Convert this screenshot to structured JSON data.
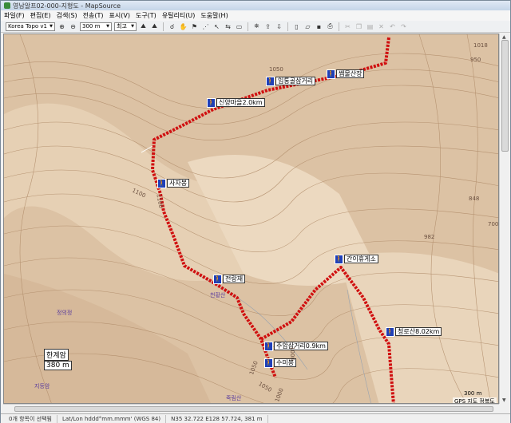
{
  "window": {
    "title": "영남알프02-000-지형도 - MapSource"
  },
  "menu": [
    "파일(F)",
    "편집(E)",
    "검색(S)",
    "전송(T)",
    "표시(V)",
    "도구(T)",
    "유틸리티(U)",
    "도움말(H)"
  ],
  "toolbar": {
    "map_product": "Korea Topo v1",
    "zoom_value": "300 m",
    "detail_value": "최고"
  },
  "waypoints": [
    {
      "label": "신양마을2.0km"
    },
    {
      "label": "임통골삼거리"
    },
    {
      "label": "쌤물산장"
    },
    {
      "label": "사자봉"
    },
    {
      "label": "전랑재"
    },
    {
      "label": "간이휴게소"
    },
    {
      "label": "주암삼거리0.9km"
    },
    {
      "label": "수미봉"
    },
    {
      "label": "청로산8.02km"
    }
  ],
  "elevations": [
    "1050",
    "1100",
    "1100",
    "1050",
    "1050",
    "1000",
    "1000",
    "950",
    "848",
    "700",
    "982",
    "1018"
  ],
  "pois": [
    "한계암",
    "정의정",
    "천황산",
    "죽림산",
    "지등암"
  ],
  "scale_labels": {
    "left": "380  m",
    "right": "300  m"
  },
  "gps_box": "GPS  지도  정복도",
  "status": {
    "selection": "0개 항목이 선택됨",
    "format": "Lat/Lon hddd°mm.mmm' (WGS 84)",
    "coords": "N35 32.722 E128 57.724, 381 m"
  },
  "colors": {
    "track": "#d01010",
    "waypoint": "#1f3fb8",
    "terrain": "#dcc2a4"
  }
}
